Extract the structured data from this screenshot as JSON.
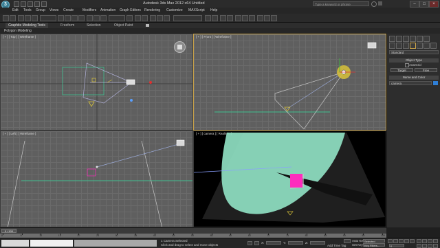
{
  "app": {
    "logo": "3ds-logo",
    "title": "Autodesk 3ds Max  2012 x64    Untitled",
    "search_placeholder": "Type a keyword or phrase",
    "window_buttons": [
      "–",
      "□",
      "×"
    ]
  },
  "menu": [
    "Edit",
    "Tools",
    "Group",
    "Views",
    "Create",
    "Modifiers",
    "Animation",
    "Graph Editors",
    "Rendering",
    "Customize",
    "MAXScript",
    "Help"
  ],
  "ribbon": {
    "tabs": [
      "Graphite Modeling Tools",
      "Freeform",
      "Selection",
      "Object Paint"
    ],
    "subtitle": "Polygon Modeling"
  },
  "viewports": {
    "top": "[ + ] [ Top ] [ Wireframe ]",
    "front": "[ + ] [ Front ] [ Wireframe ]",
    "left": "[ + ] [ Left ] [ Wireframe ]",
    "camera": "[ + ] [ camera ] [ Realistic ]"
  },
  "command_panel": {
    "dropdown": "Standard",
    "object_type": "Object Type",
    "autogrid": "AutoGrid",
    "buttons": [
      "Target",
      "Free"
    ],
    "name_color": "Name and Color",
    "name_value": "camera",
    "swatch": "#2f7fd6"
  },
  "timeline": {
    "frame": "0 / 100",
    "ticks": [
      "0",
      "5",
      "10",
      "15",
      "20",
      "25",
      "30",
      "35",
      "40",
      "45",
      "50",
      "55",
      "60",
      "65",
      "70",
      "75",
      "80",
      "85",
      "90",
      "95",
      "100"
    ]
  },
  "status": {
    "selection": "1 Camera Selected",
    "prompt": "Click and drag to select and move objects",
    "x_value": "",
    "y_value": "",
    "z_value": "",
    "auto_key": "Auto Key",
    "set_key": "Set Key",
    "selected": "Selected",
    "add_time_tag": "Add Time Tag",
    "key_filters": "Key Filters...",
    "frame_field": "0"
  },
  "colors": {
    "active_border": "#c9a34a",
    "light_yellow": "#d8c23a",
    "spot_green": "#8fe0c2",
    "box_magenta": "#ff2bbd"
  }
}
